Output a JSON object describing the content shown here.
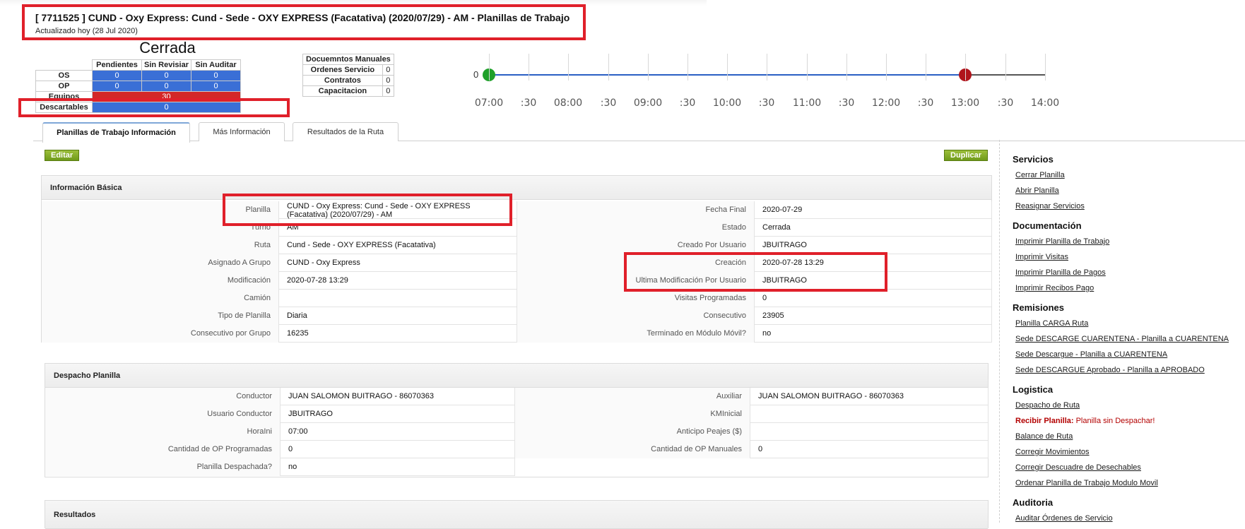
{
  "header": {
    "title": "[ 7711525 ] CUND - Oxy Express: Cund - Sede - OXY EXPRESS (Facatativa) (2020/07/29) - AM - Planillas de Trabajo",
    "updated": "Actualizado hoy (28 Jul 2020)"
  },
  "status": {
    "state": "Cerrada",
    "columns": [
      "Pendientes",
      "Sin Revisiar",
      "Sin Auditar"
    ],
    "rows": [
      {
        "label": "OS",
        "values": [
          "0",
          "0",
          "0"
        ]
      },
      {
        "label": "OP",
        "values": [
          "0",
          "0",
          "0"
        ]
      }
    ],
    "equipos": {
      "label": "Equipos",
      "value": "30"
    },
    "descartables": {
      "label": "Descartables",
      "value": "0"
    }
  },
  "manual_docs": {
    "title": "Docuemntos Manuales",
    "rows": [
      {
        "label": "Ordenes Servicio",
        "value": "0"
      },
      {
        "label": "Contratos",
        "value": "0"
      },
      {
        "label": "Capacitacion",
        "value": "0"
      }
    ]
  },
  "timeline": {
    "start_value": "0",
    "ticks": [
      "07:00",
      ":30",
      "08:00",
      ":30",
      "09:00",
      ":30",
      "10:00",
      ":30",
      "11:00",
      ":30",
      "12:00",
      ":30",
      "13:00",
      ":30",
      "14:00"
    ],
    "start_color": "#1fa02a",
    "end_color": "#b0141c",
    "line_color": "#2a5fc4"
  },
  "tabs": [
    "Planillas de Trabajo Información",
    "Más Información",
    "Resultados de la Ruta"
  ],
  "buttons": {
    "edit": "Editar",
    "duplicate": "Duplicar"
  },
  "basic_info": {
    "title": "Información Básica",
    "left": [
      {
        "label": "Planilla",
        "value": "CUND - Oxy Express: Cund - Sede - OXY EXPRESS (Facatativa) (2020/07/29) - AM"
      },
      {
        "label": "Turno",
        "value": "AM"
      },
      {
        "label": "Ruta",
        "value": "Cund - Sede - OXY EXPRESS (Facatativa)"
      },
      {
        "label": "Asignado A Grupo",
        "value": "CUND - Oxy Express"
      },
      {
        "label": "Modificación",
        "value": "2020-07-28 13:29"
      },
      {
        "label": "Camión",
        "value": ""
      },
      {
        "label": "Tipo de Planilla",
        "value": "Diaria"
      },
      {
        "label": "Consecutivo por Grupo",
        "value": "16235"
      }
    ],
    "right": [
      {
        "label": "Fecha Final",
        "value": "2020-07-29"
      },
      {
        "label": "Estado",
        "value": "Cerrada"
      },
      {
        "label": "Creado Por Usuario",
        "value": "JBUITRAGO"
      },
      {
        "label": "Creación",
        "value": "2020-07-28 13:29"
      },
      {
        "label": "Ultima Modificación Por Usuario",
        "value": "JBUITRAGO"
      },
      {
        "label": "Visitas Programadas",
        "value": "0"
      },
      {
        "label": "Consecutivo",
        "value": "23905"
      },
      {
        "label": "Terminado en Módulo Móvil?",
        "value": "no"
      }
    ]
  },
  "dispatch": {
    "title": "Despacho Planilla",
    "left": [
      {
        "label": "Conductor",
        "value": "JUAN SALOMON BUITRAGO - 86070363"
      },
      {
        "label": "Usuario Conductor",
        "value": "JBUITRAGO"
      },
      {
        "label": "HoraIni",
        "value": "07:00"
      },
      {
        "label": "Cantidad de OP Programadas",
        "value": "0"
      },
      {
        "label": "Planilla Despachada?",
        "value": "no"
      }
    ],
    "right": [
      {
        "label": "Auxiliar",
        "value": "JUAN SALOMON BUITRAGO - 86070363"
      },
      {
        "label": "KMInicial",
        "value": ""
      },
      {
        "label": "Anticipo Peajes ($)",
        "value": ""
      },
      {
        "label": "Cantidad de OP Manuales",
        "value": "0"
      }
    ]
  },
  "results": {
    "title": "Resultados"
  },
  "sidebar": {
    "groups": [
      {
        "title": "Servicios",
        "items": [
          {
            "label": "Cerrar Planilla"
          },
          {
            "label": "Abrir Planilla"
          },
          {
            "label": "Reasignar Servicios"
          }
        ]
      },
      {
        "title": "Documentación",
        "items": [
          {
            "label": "Imprimir Planilla de Trabajo"
          },
          {
            "label": "Imprimir Visitas"
          },
          {
            "label": "Imprimir Planilla de Pagos"
          },
          {
            "label": "Imprimir Recibos Pago"
          }
        ]
      },
      {
        "title": "Remisiones",
        "items": [
          {
            "label": "Planilla CARGA Ruta"
          },
          {
            "label": "Sede DESCARGE CUARENTENA - Planilla a CUARENTENA"
          },
          {
            "label": "Sede Descargue - Planilla a CUARENTENA"
          },
          {
            "label": "Sede DESCARGUE Aprobado - Planilla a APROBADO"
          }
        ]
      },
      {
        "title": "Logistica",
        "items": [
          {
            "label": "Despacho de Ruta"
          },
          {
            "label": "Recibir Planilla:",
            "note": "Planilla sin Despachar!"
          },
          {
            "label": "Balance de Ruta"
          },
          {
            "label": "Corregir Movimientos"
          },
          {
            "label": "Corregir Descuadre de Desechables"
          },
          {
            "label": "Ordenar Planilla de Trabajo Modulo Movil"
          }
        ]
      },
      {
        "title": "Auditoria",
        "items": [
          {
            "label": "Auditar Órdenes de Servicio"
          }
        ]
      }
    ]
  }
}
